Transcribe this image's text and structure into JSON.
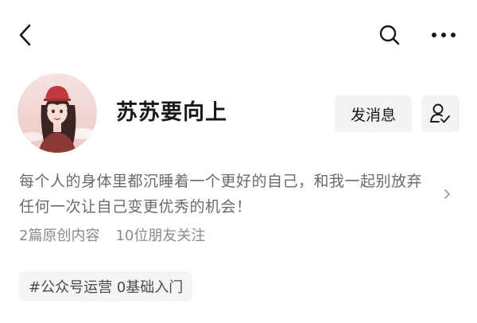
{
  "nav": {
    "back_icon": "chevron-left-icon",
    "search_icon": "search-icon",
    "more_icon": "more-horizontal-icon"
  },
  "profile": {
    "name": "苏苏要向上",
    "message_button": "发消息",
    "follow_icon": "user-check-icon",
    "bio": "每个人的身体里都沉睡着一个更好的自己，和我一起别放弃任何一次让自己变更优秀的机会！",
    "stats": {
      "articles": "2篇原创内容",
      "friends": "10位朋友关注"
    },
    "tag": "#公众号运营 0基础入门"
  },
  "colors": {
    "text_primary": "#191919",
    "text_secondary": "#6b6b6b",
    "text_muted": "#8a8a8a",
    "button_bg": "#f3f3f3"
  }
}
